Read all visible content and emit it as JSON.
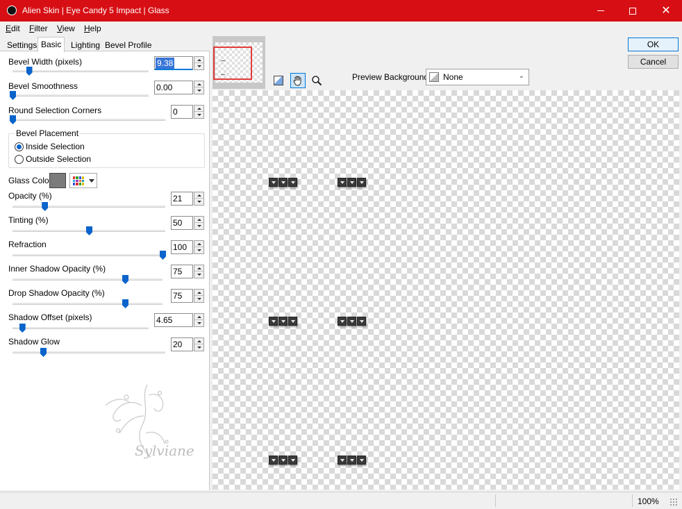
{
  "window": {
    "title": "Alien Skin | Eye Candy 5 Impact | Glass",
    "accent_color": "#d70f14",
    "controls": [
      "minimize-icon",
      "maximize-icon",
      "close-icon"
    ]
  },
  "menu": {
    "items": [
      "Edit",
      "Filter",
      "View",
      "Help"
    ]
  },
  "tabs": [
    "Settings",
    "Basic",
    "Lighting",
    "Bevel Profile"
  ],
  "active_tab": "Basic",
  "params": {
    "bevel_width": {
      "label": "Bevel Width (pixels)",
      "value": "9.38",
      "level": 0.12
    },
    "bevel_smoothness": {
      "label": "Bevel Smoothness",
      "value": "0.00",
      "level": 0.0
    },
    "round_corners": {
      "label": "Round Selection Corners",
      "value": "0",
      "level": 0.0
    },
    "bevel_placement": {
      "title": "Bevel Placement",
      "options": [
        "Inside Selection",
        "Outside Selection"
      ],
      "selected": "Inside Selection"
    },
    "glass_color": {
      "label": "Glass Color",
      "color": "#7b7b7b"
    },
    "opacity": {
      "label": "Opacity (%)",
      "value": "21",
      "level": 0.21
    },
    "tinting": {
      "label": "Tinting (%)",
      "value": "50",
      "level": 0.5
    },
    "refraction": {
      "label": "Refraction",
      "value": "100",
      "level": 1.0
    },
    "inner_shadow": {
      "label": "Inner Shadow Opacity (%)",
      "value": "75",
      "level": 0.75
    },
    "drop_shadow": {
      "label": "Drop Shadow Opacity (%)",
      "value": "75",
      "level": 0.75
    },
    "shadow_offset": {
      "label": "Shadow Offset (pixels)",
      "value": "4.65",
      "level": 0.07
    },
    "shadow_glow": {
      "label": "Shadow Glow",
      "value": "20",
      "level": 0.2
    }
  },
  "watermark": {
    "text": "Sylviane"
  },
  "buttons": {
    "ok": "OK",
    "cancel": "Cancel"
  },
  "preview": {
    "background_label": "Preview Background:",
    "background_value": "None",
    "tools": [
      "navigator-icon",
      "hand-icon",
      "zoom-icon"
    ]
  },
  "status": {
    "zoom": "100%"
  }
}
